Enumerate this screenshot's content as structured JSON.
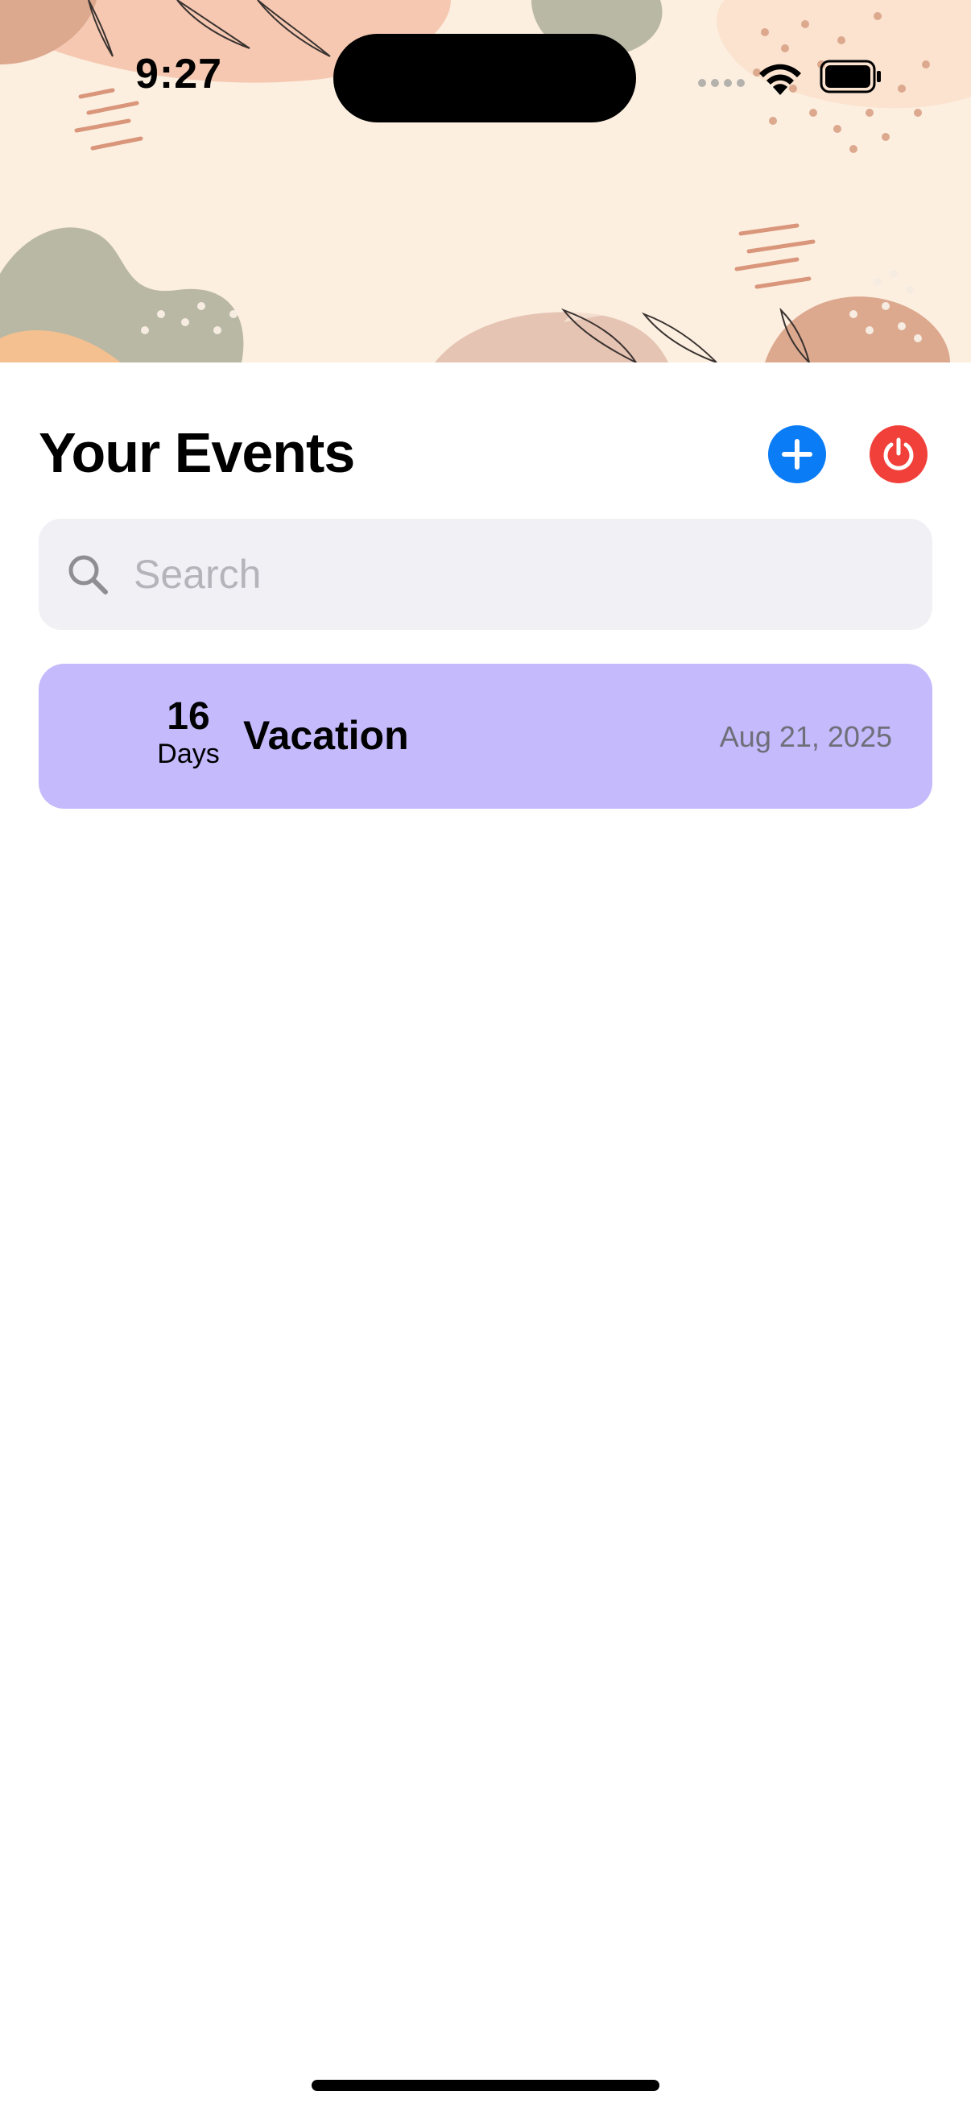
{
  "status_bar": {
    "time": "9:27"
  },
  "header": {
    "title": "Your Events",
    "add_icon": "plus-icon",
    "power_icon": "power-icon",
    "colors": {
      "add": "#0a7cf5",
      "power": "#f1403a"
    }
  },
  "search": {
    "placeholder": "Search",
    "value": ""
  },
  "events": [
    {
      "count": "16",
      "unit": "Days",
      "name": "Vacation",
      "date": "Aug 21, 2025",
      "color": "#c4bafc"
    }
  ]
}
